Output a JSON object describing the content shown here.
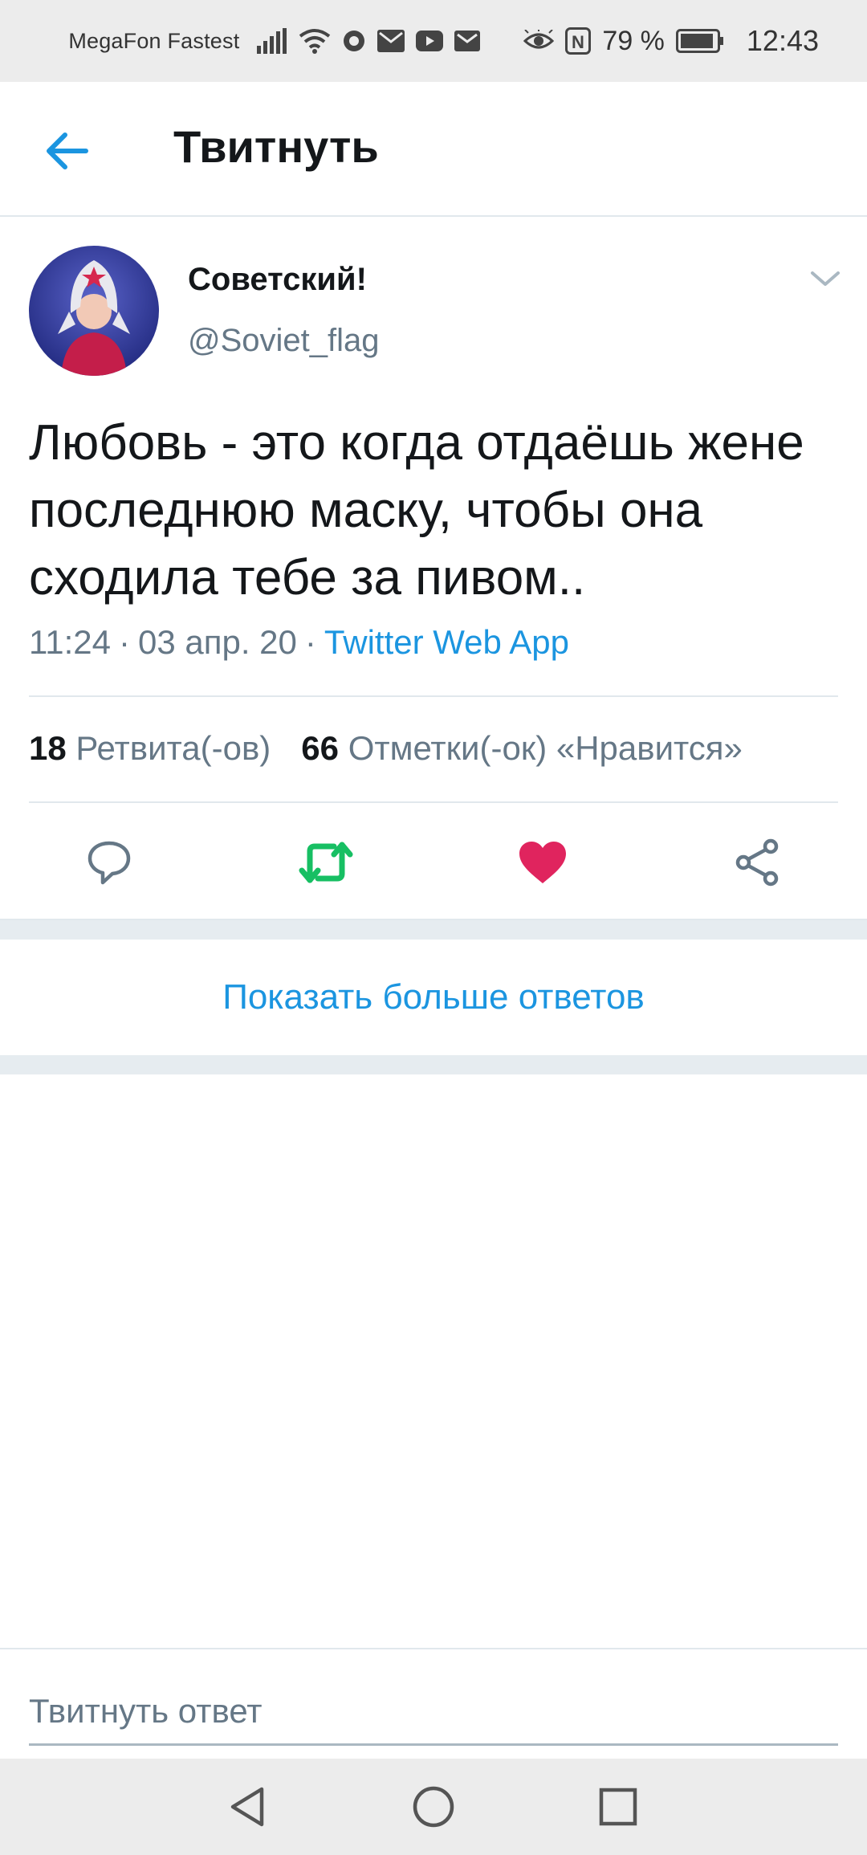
{
  "status_bar": {
    "carrier": "MegaFon Fastest",
    "nfc_label": "N",
    "battery_percent": "79 %",
    "time": "12:43",
    "icons": [
      "signal-icon",
      "wifi-icon",
      "notification-app-icon",
      "mail-icon",
      "youtube-icon",
      "gmail-icon",
      "eye-comfort-icon",
      "nfc-icon",
      "battery-icon"
    ]
  },
  "header": {
    "title": "Твитнуть",
    "back_icon": "arrow-left-icon"
  },
  "tweet": {
    "user_name": "Советский!",
    "user_handle": "@Soviet_flag",
    "text": "Любовь - это когда отдаёшь жене последнюю маску, чтобы она сходила тебе за пивом..",
    "time": "11:24",
    "date": "03 апр. 20",
    "separator": "·",
    "source": "Twitter Web App",
    "retweet_count": "18",
    "retweet_label": "Ретвита(-ов)",
    "like_count": "66",
    "like_label": "Отметки(-ок) «Нравится»",
    "liked": true
  },
  "actions": [
    "reply-icon",
    "retweet-icon",
    "like-icon",
    "share-icon"
  ],
  "more_replies_label": "Показать больше ответов",
  "reply": {
    "placeholder": "Твитнуть ответ"
  },
  "colors": {
    "accent": "#1b95e0",
    "retweet_green": "#17bf63",
    "like_red": "#e0245e",
    "secondary_text": "#657786",
    "divider": "#e1e8ed"
  }
}
